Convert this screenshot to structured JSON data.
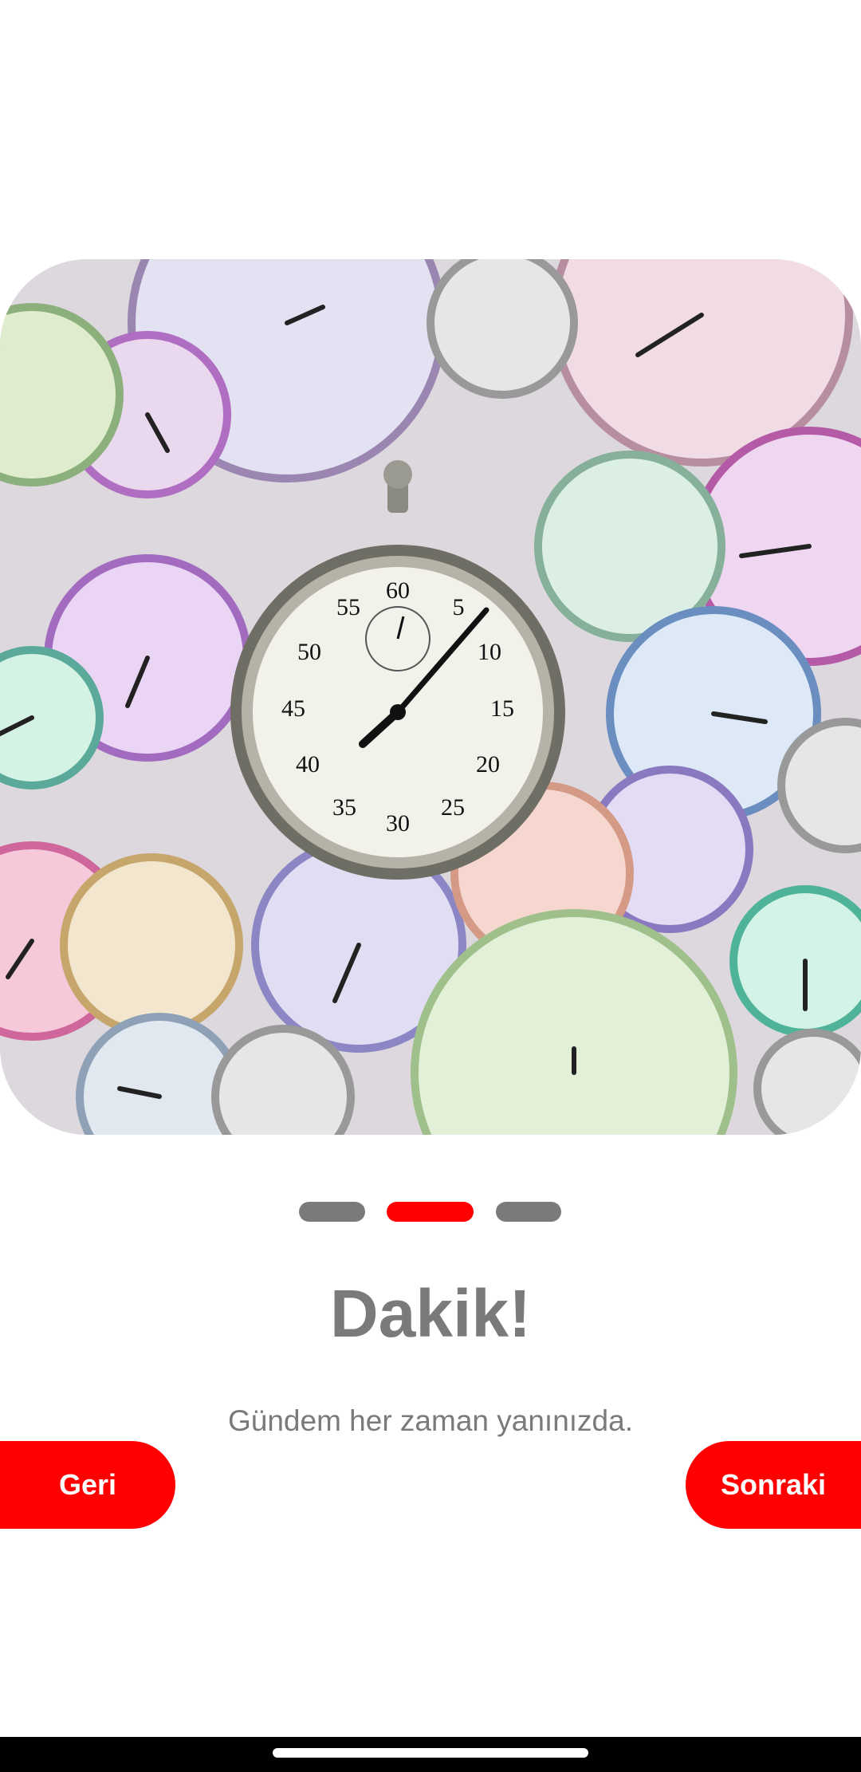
{
  "hero": {
    "image": "stopwatch-collage-image"
  },
  "pager": {
    "count": 3,
    "active_index": 1,
    "active_color": "#ff0000",
    "inactive_color": "#7a7a7a"
  },
  "content": {
    "title": "Dakik!",
    "subtitle": "Gündem her zaman yanınızda."
  },
  "buttons": {
    "back_label": "Geri",
    "next_label": "Sonraki",
    "color": "#ff0000"
  },
  "stopwatch": {
    "numbers": [
      "60",
      "5",
      "10",
      "15",
      "20",
      "25",
      "30",
      "35",
      "40",
      "45",
      "50",
      "55"
    ]
  }
}
